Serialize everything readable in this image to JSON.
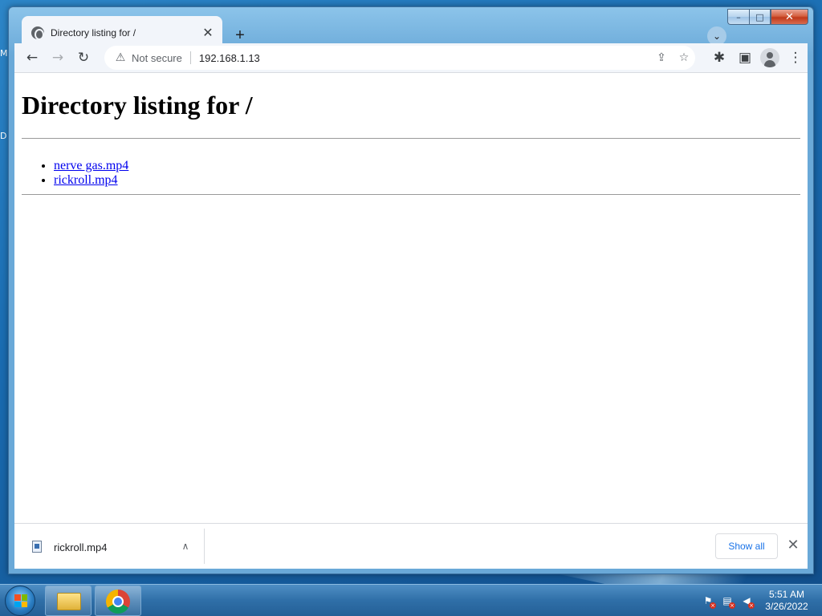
{
  "desktop": {
    "edge_letters": [
      "M",
      "D"
    ]
  },
  "browser": {
    "tab": {
      "title": "Directory listing for /",
      "close_glyph": "✕"
    },
    "new_tab_glyph": "+",
    "tab_search_glyph": "⌄",
    "toolbar": {
      "back_glyph": "←",
      "forward_glyph": "→",
      "reload_glyph": "↻",
      "security_icon": "warning-icon",
      "security_text": "Not secure",
      "url": "192.168.1.13",
      "share_glyph": "⇪",
      "bookmark_glyph": "☆",
      "extensions_glyph": "✱",
      "side_panel_glyph": "▣",
      "menu_glyph": "⋮"
    },
    "window_controls": {
      "minimize_glyph": "–",
      "maximize_glyph": "□",
      "close_glyph": "✕"
    }
  },
  "page": {
    "heading": "Directory listing for /",
    "files": [
      {
        "name": "nerve gas.mp4"
      },
      {
        "name": "rickroll.mp4"
      }
    ]
  },
  "downloads": {
    "item_name": "rickroll.mp4",
    "chevron_glyph": "∧",
    "show_all_label": "Show all",
    "close_glyph": "✕"
  },
  "taskbar": {
    "time": "5:51 AM",
    "date": "3/26/2022",
    "colors": {
      "start_flag": [
        "#f25022",
        "#7fba00",
        "#00a4ef",
        "#ffb900"
      ]
    }
  }
}
